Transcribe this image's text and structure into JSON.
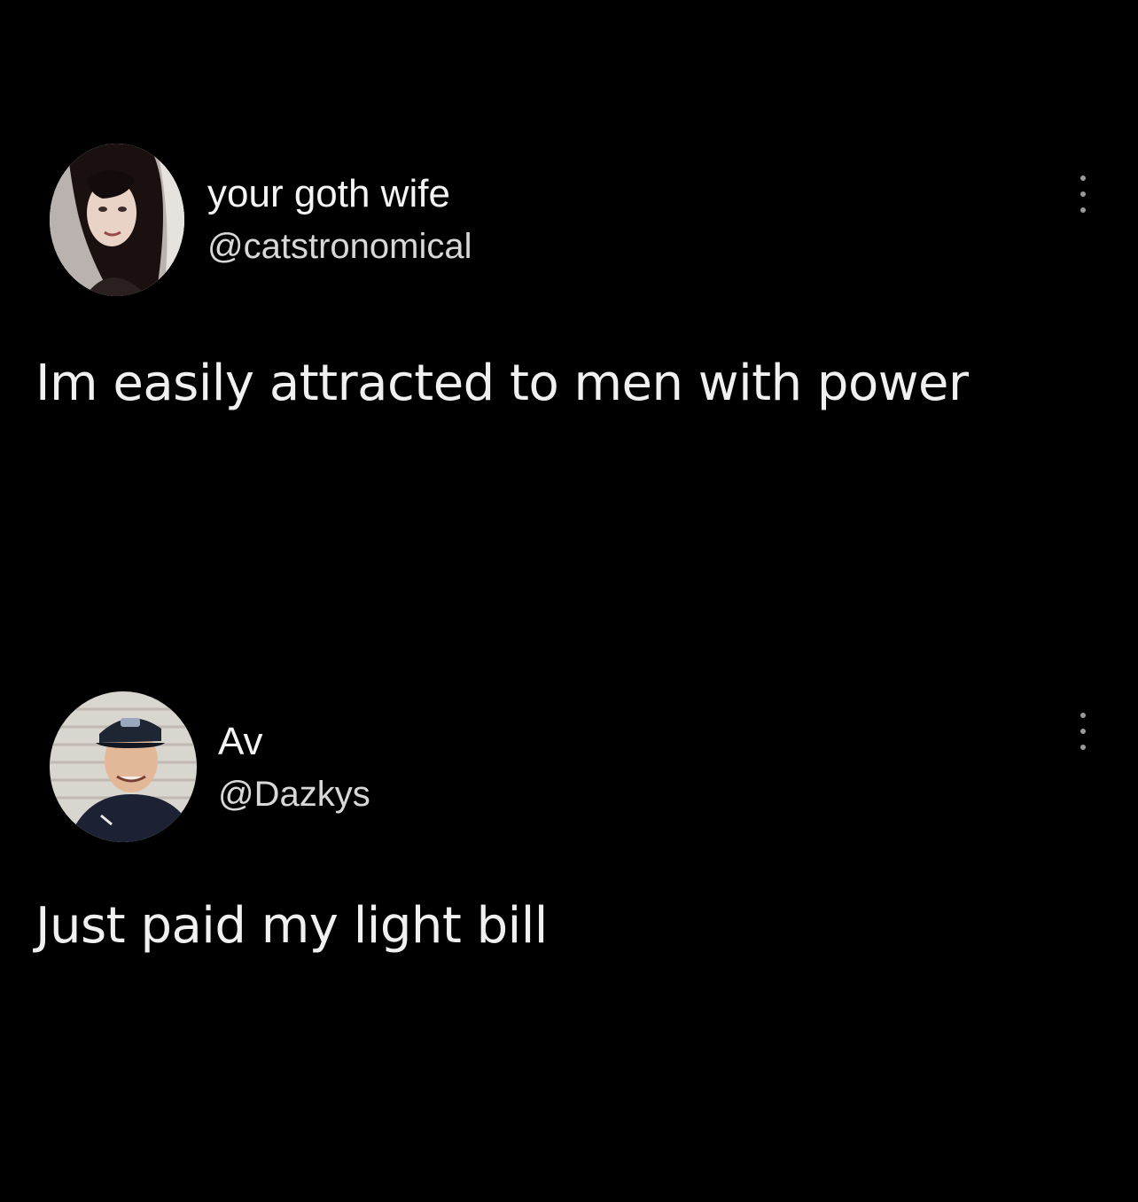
{
  "tweets": [
    {
      "display_name": "your goth wife",
      "handle": "@catstronomical",
      "text": "Im easily attracted to men with power",
      "avatar_icon": "profile-photo"
    },
    {
      "display_name": "Av",
      "handle": "@Dazkys",
      "text": "Just paid my light bill",
      "avatar_icon": "profile-photo"
    }
  ],
  "colors": {
    "background": "#000000",
    "text": "#f0f0f0",
    "handle": "#d8d8d8",
    "more_dots": "#9a9a9a"
  },
  "icons": {
    "more": "more-options-icon"
  }
}
